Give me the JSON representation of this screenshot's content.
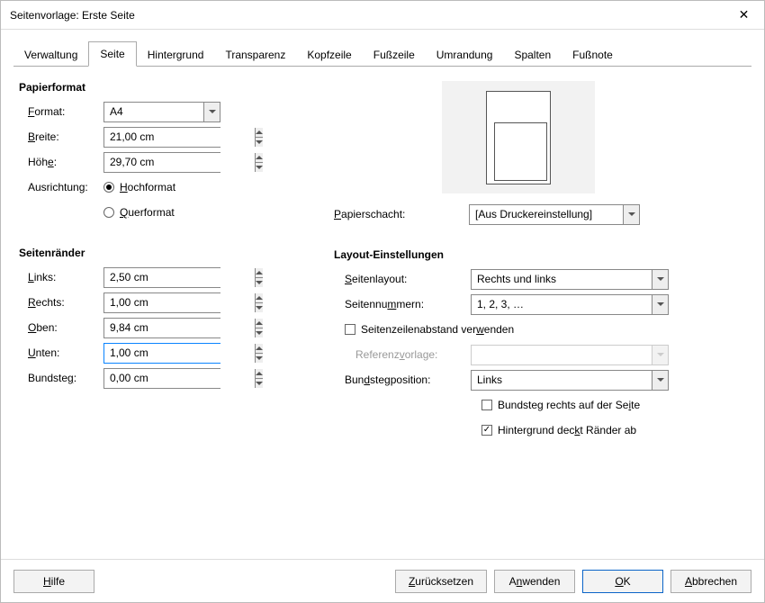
{
  "window": {
    "title": "Seitenvorlage: Erste Seite"
  },
  "tabs": [
    "Verwaltung",
    "Seite",
    "Hintergrund",
    "Transparenz",
    "Kopfzeile",
    "Fußzeile",
    "Umrandung",
    "Spalten",
    "Fußnote"
  ],
  "active_tab_index": 1,
  "paper": {
    "section": "Papierformat",
    "format_label": "Format:",
    "format_value": "A4",
    "width_label": "Breite:",
    "width_value": "21,00 cm",
    "height_label": "Höhe:",
    "height_value": "29,70 cm",
    "orientation_label": "Ausrichtung:",
    "portrait": "Hochformat",
    "landscape": "Querformat",
    "orientation_value": "portrait",
    "tray_label": "Papierschacht:",
    "tray_value": "[Aus Druckereinstellung]"
  },
  "margins": {
    "section": "Seitenränder",
    "left_label": "Links:",
    "left_value": "2,50 cm",
    "right_label": "Rechts:",
    "right_value": "1,00 cm",
    "top_label": "Oben:",
    "top_value": "9,84 cm",
    "bottom_label": "Unten:",
    "bottom_value": "1,00 cm",
    "gutter_label": "Bundsteg:",
    "gutter_value": "0,00 cm",
    "focused_field": "bottom"
  },
  "layout": {
    "section": "Layout-Einstellungen",
    "page_layout_label": "Seitenlayout:",
    "page_layout_value": "Rechts und links",
    "page_numbers_label": "Seitennummern:",
    "page_numbers_value": "1, 2, 3, …",
    "register_label": "Seitenzeilenabstand verwenden",
    "register_checked": false,
    "ref_style_label": "Referenzvorlage:",
    "ref_style_value": "",
    "ref_style_enabled": false,
    "gutter_pos_label": "Bundstegposition:",
    "gutter_pos_value": "Links",
    "gutter_right_label": "Bundsteg rechts auf der Seite",
    "gutter_right_checked": false,
    "bg_covers_label": "Hintergrund deckt Ränder ab",
    "bg_covers_checked": true
  },
  "footer": {
    "help": "Hilfe",
    "reset": "Zurücksetzen",
    "apply": "Anwenden",
    "ok": "OK",
    "cancel": "Abbrechen"
  }
}
